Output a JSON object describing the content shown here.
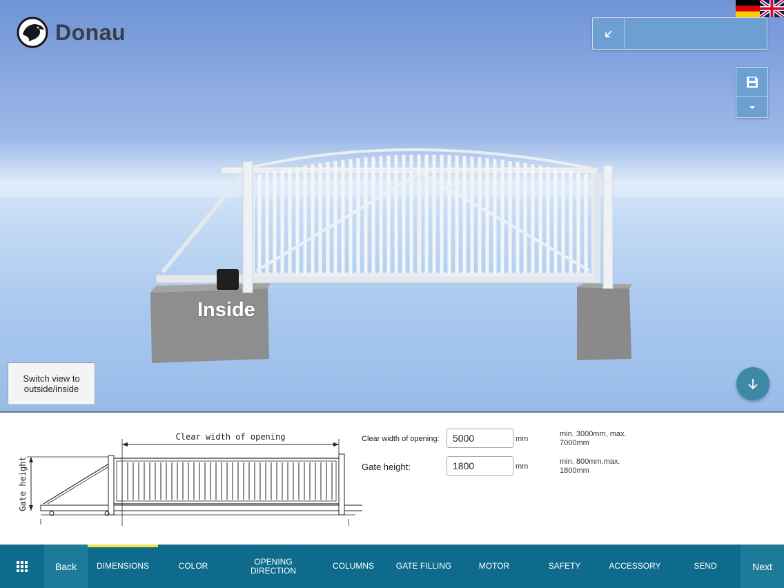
{
  "brand": {
    "name": "Donau"
  },
  "languages": [
    {
      "name": "German",
      "icon": "german-flag-icon"
    },
    {
      "name": "English",
      "icon": "uk-flag-icon"
    }
  ],
  "viewer": {
    "view_label": "Inside",
    "switch_button_label": "Switch view to outside/inside"
  },
  "drawing": {
    "width_label": "Clear width of opening",
    "height_label": "Gate height"
  },
  "form": {
    "width": {
      "label": "Clear width of opening:",
      "value": "5000",
      "unit": "mm",
      "limits": "min. 3000mm, max. 7000mm"
    },
    "height": {
      "label": "Gate height:",
      "value": "1800",
      "unit": "mm",
      "limits": "min. 800mm,max. 1800mm"
    }
  },
  "nav": {
    "back_label": "Back",
    "next_label": "Next",
    "active_step": "DIMENSIONS",
    "steps": [
      "DIMENSIONS",
      "COLOR",
      "OPENING DIRECTION",
      "COLUMNS",
      "GATE FILLING",
      "MOTOR",
      "SAFETY",
      "ACCESSORY",
      "SEND"
    ]
  },
  "colors": {
    "nav_background": "#0f6b8b",
    "nav_button": "#1d7b99",
    "active_indicator": "#f2e24a",
    "panel_button": "#6d9fd3",
    "fab": "#3e8aa6"
  }
}
